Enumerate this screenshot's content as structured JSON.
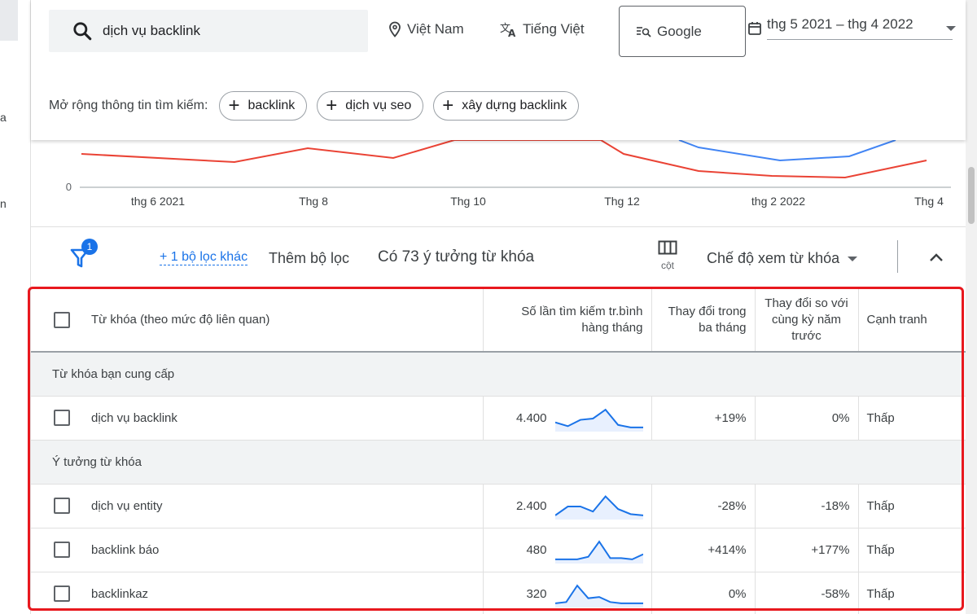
{
  "header": {
    "search_query": "dịch vụ backlink",
    "location": "Việt Nam",
    "language": "Tiếng Việt",
    "search_engine": "Google",
    "date_range": "thg 5 2021 – thg 4 2022",
    "expand_label": "Mở rộng thông tin tìm kiếm:",
    "chips": [
      "backlink",
      "dịch vụ seo",
      "xây dựng backlink"
    ]
  },
  "chart_data": {
    "type": "line",
    "x": [
      "thg 6 2021",
      "Thg 8",
      "Thg 10",
      "Thg 12",
      "thg 2 2022",
      "Thg 4"
    ],
    "y_tick_visible": "0",
    "series": [
      {
        "color": "#ea4335",
        "values": [
          " "
        ]
      },
      {
        "color": "#4285f4",
        "values": [
          " "
        ]
      }
    ]
  },
  "filterbar": {
    "filter_count": "1",
    "more_filters_link": "+ 1 bộ lọc khác",
    "add_filter": "Thêm bộ lọc",
    "idea_count": "Có 73 ý tưởng từ khóa",
    "columns_label": "cột",
    "view_mode": "Chế độ xem từ khóa"
  },
  "table": {
    "headers": {
      "keyword": "Từ khóa (theo mức độ liên quan)",
      "volume": "Số lần tìm kiếm tr.bình hàng tháng",
      "three_month": "Thay đổi trong ba tháng",
      "yoy": "Thay đổi so với cùng kỳ năm trước",
      "competition": "Cạnh tranh"
    },
    "group_provided": "Từ khóa bạn cung cấp",
    "group_ideas": "Ý tưởng từ khóa",
    "rows": [
      {
        "keyword": "dịch vụ backlink",
        "volume": "4.400",
        "three_month": "+19%",
        "yoy": "0%",
        "competition": "Thấp",
        "trend": [
          6,
          3,
          8,
          9,
          16,
          4,
          2,
          2
        ]
      },
      {
        "keyword": "dịch vụ entity",
        "volume": "2.400",
        "three_month": "-28%",
        "yoy": "-18%",
        "competition": "Thấp",
        "trend": [
          2,
          9,
          9,
          5,
          17,
          7,
          3,
          2
        ]
      },
      {
        "keyword": "backlink báo",
        "volume": "480",
        "three_month": "+414%",
        "yoy": "+177%",
        "competition": "Thấp",
        "trend": [
          2,
          2,
          2,
          4,
          16,
          3,
          3,
          2,
          6
        ]
      },
      {
        "keyword": "backlinkaz",
        "volume": "320",
        "three_month": "0%",
        "yoy": "-58%",
        "competition": "Thấp",
        "trend": [
          2,
          3,
          16,
          6,
          7,
          3,
          2,
          2,
          2
        ]
      }
    ]
  },
  "colors": {
    "accent": "#1a73e8",
    "highlight": "#e8181e",
    "red_series": "#ea4335",
    "blue_series": "#4285f4"
  }
}
